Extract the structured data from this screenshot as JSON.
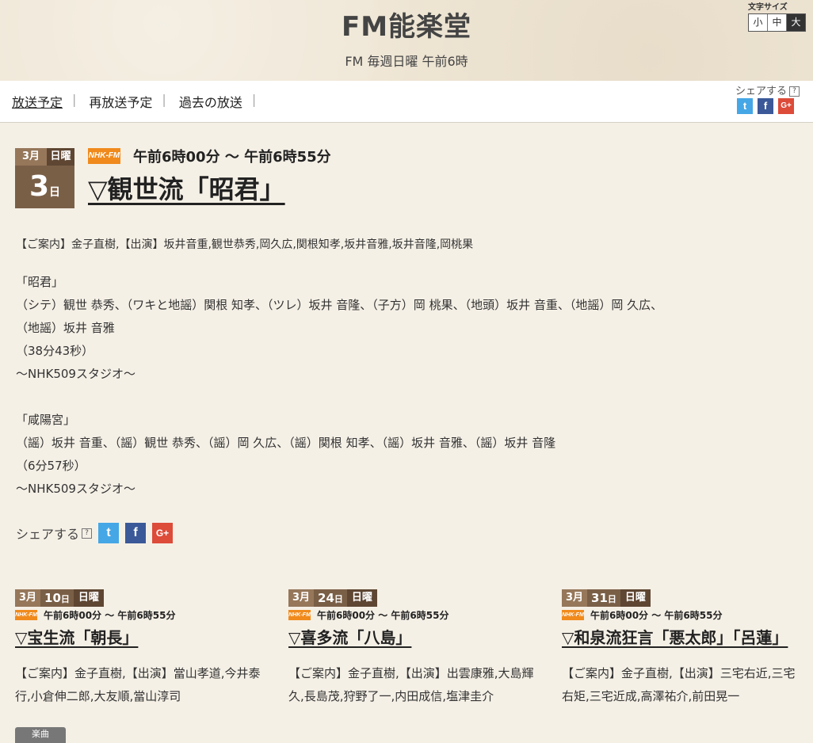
{
  "header": {
    "title": "FM能楽堂",
    "subtitle": "FM 毎週日曜 午前6時",
    "font_size_label": "文字サイズ",
    "font_sizes": [
      "小",
      "中",
      "大"
    ]
  },
  "nav": {
    "items": [
      "放送予定",
      "再放送予定",
      "過去の放送"
    ],
    "separator": "|",
    "share_label": "シェアする",
    "help": "?"
  },
  "social": {
    "twitter": "t",
    "facebook": "f",
    "google": "G+"
  },
  "program": {
    "month": "3月",
    "weekday": "日曜",
    "day": "3",
    "day_unit": "日",
    "channel": "NHK-FM",
    "time": "午前6時00分 〜 午前6時55分",
    "title": "▽観世流「昭君」",
    "guide": "【ご案内】金子直樹,【出演】坂井音重,観世恭秀,岡久広,関根知孝,坂井音雅,坂井音隆,岡桃果",
    "lines": [
      "「昭君」",
      "（シテ）観世 恭秀、（ワキと地謡）関根 知孝、（ツレ）坂井 音隆、（子方）岡 桃果、（地頭）坂井 音重、（地謡）岡 久広、",
      "（地謡）坂井 音雅",
      "（38分43秒）",
      "〜NHK509スタジオ〜",
      "",
      "「咸陽宮」",
      "（謡）坂井 音重、（謡）観世 恭秀、（謡）岡 久広、（謡）関根 知孝、（謡）坂井 音雅、（謡）坂井 音隆",
      "（6分57秒）",
      "〜NHK509スタジオ〜"
    ],
    "share_label": "シェアする"
  },
  "cards": [
    {
      "month": "3月",
      "day": "10",
      "day_unit": "日",
      "weekday": "日曜",
      "time": "午前6時00分 〜 午前6時55分",
      "title": "▽宝生流「朝長」",
      "guide": "【ご案内】金子直樹,【出演】當山孝道,今井泰行,小倉伸二郎,大友順,當山淳司",
      "tag": "楽曲"
    },
    {
      "month": "3月",
      "day": "24",
      "day_unit": "日",
      "weekday": "日曜",
      "time": "午前6時00分 〜 午前6時55分",
      "title": "▽喜多流「八島」",
      "guide": "【ご案内】金子直樹,【出演】出雲康雅,大島輝久,長島茂,狩野了一,内田成信,塩津圭介"
    },
    {
      "month": "3月",
      "day": "31",
      "day_unit": "日",
      "weekday": "日曜",
      "time": "午前6時00分 〜 午前6時55分",
      "title": "▽和泉流狂言「悪太郎」「呂蓮」",
      "guide": "【ご案内】金子直樹,【出演】三宅右近,三宅右矩,三宅近成,高澤祐介,前田晃一"
    }
  ]
}
